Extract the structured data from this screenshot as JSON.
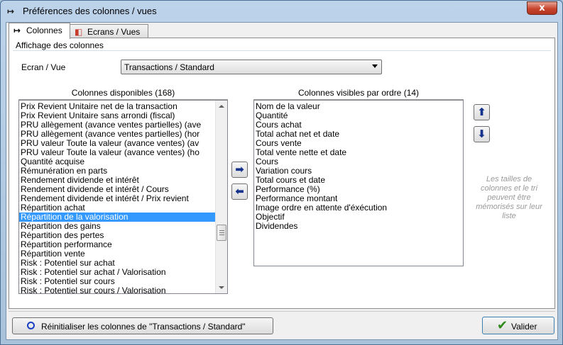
{
  "window": {
    "title": "Préférences des colonnes / vues",
    "app_icon": "pin-arrow-icon",
    "close_label": "x"
  },
  "tabs": [
    {
      "label": "Colonnes",
      "icon": "pin-arrow-icon",
      "active": true
    },
    {
      "label": "Ecrans / Vues",
      "icon": "screens-icon",
      "active": false
    }
  ],
  "group": {
    "title": "Affichage des colonnes"
  },
  "ecran_vue": {
    "label": "Ecran / Vue",
    "selected": "Transactions / Standard"
  },
  "available": {
    "header": "Colonnes disponibles (168)",
    "selected_index": 12,
    "items": [
      "Prix Revient Unitaire net de la transaction",
      "Prix Revient Unitaire sans arrondi (fiscal)",
      "PRU allègement (avance ventes partielles) (ave",
      "PRU allègement (avance ventes partielles) (hor",
      "PRU valeur Toute la valeur (avance ventes) (av",
      "PRU valeur Toute la valeur (avance ventes) (ho",
      "Quantité acquise",
      "Rémunération en parts",
      "Rendement dividende et intérêt",
      "Rendement dividende et intérêt / Cours",
      "Rendement dividende et intérêt / Prix revient",
      "Répartition achat",
      "Répartition de la valorisation",
      "Répartition des gains",
      "Répartition des pertes",
      "Répartition performance",
      "Répartition vente",
      "Risk : Potentiel sur achat",
      "Risk : Potentiel sur achat / Valorisation",
      "Risk : Potentiel sur cours",
      "Risk : Potentiel sur cours / Valorisation"
    ]
  },
  "visible": {
    "header": "Colonnes visibles par ordre (14)",
    "items": [
      "Nom de la valeur",
      "Quantité",
      "Cours achat",
      "Total achat net et date",
      "Cours vente",
      "Total vente nette et date",
      "Cours",
      "Variation cours",
      "Total cours et date",
      "Performance (%)",
      "Performance montant",
      "Image ordre en attente d'éxécution",
      "Objectif",
      "Dividendes"
    ]
  },
  "move_buttons": {
    "add_icon": "arrow-right-icon",
    "remove_icon": "arrow-left-icon",
    "up_icon": "arrow-up-icon",
    "down_icon": "arrow-down-icon"
  },
  "hint": "Les tailles de colonnes et le tri peuvent être mémorisés sur leur liste",
  "reset_button": {
    "label": "Réinitialiser les colonnes de \"Transactions / Standard\"",
    "icon": "ring-icon"
  },
  "validate_button": {
    "label": "Valider",
    "icon": "checkmark-icon"
  },
  "colors": {
    "selection": "#3399ff",
    "close": "#c7442d",
    "arrows": "#15338c"
  }
}
